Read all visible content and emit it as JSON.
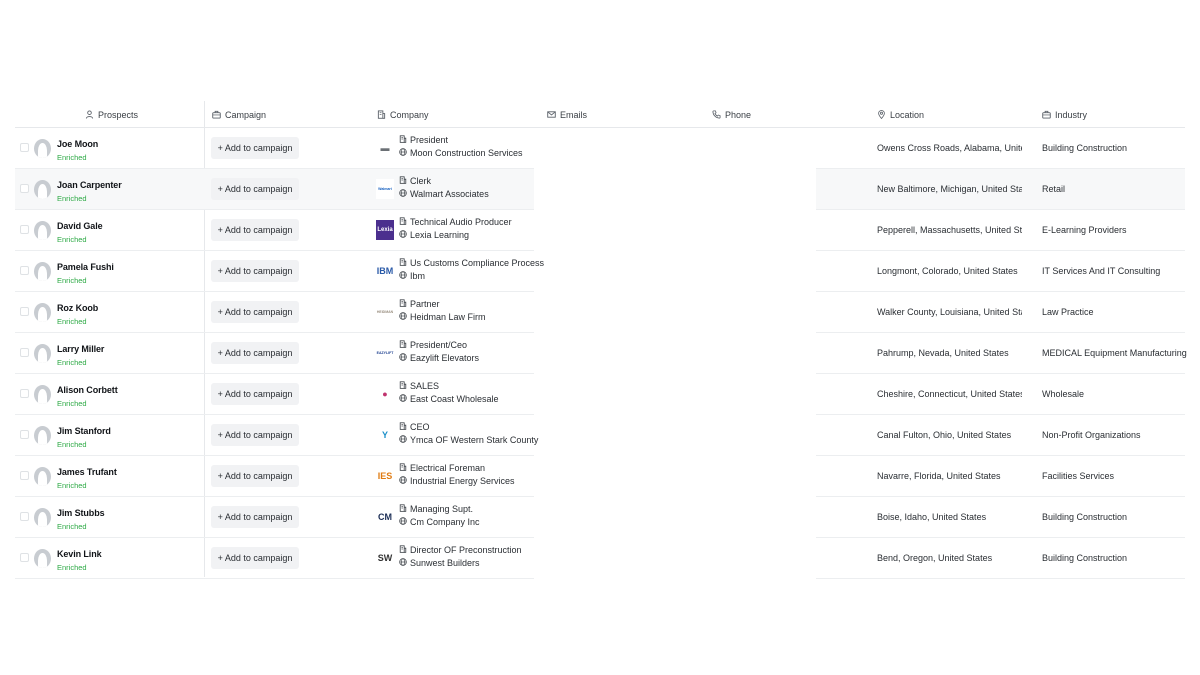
{
  "headers": {
    "prospects": "Prospects",
    "campaign": "Campaign",
    "company": "Company",
    "emails": "Emails",
    "phone": "Phone",
    "location": "Location",
    "industry": "Industry"
  },
  "icons": {
    "prospects": "person-icon",
    "campaign": "briefcase-icon",
    "company": "building-icon",
    "emails": "envelope-icon",
    "phone": "phone-icon",
    "location": "location-pin-icon",
    "industry": "briefcase-icon",
    "title": "building-icon",
    "website": "globe-icon"
  },
  "colors": {
    "enriched": "#2eaa46"
  },
  "add_to_campaign_label": "+ Add to campaign",
  "rows": [
    {
      "name": "Joe Moon",
      "status": "Enriched",
      "title": "President",
      "company": "Moon Construction Services",
      "location": "Owens Cross Roads, Alabama, United",
      "industry": "Building Construction",
      "logo": "▬",
      "logo_color": "#6b7075",
      "logo_bg": "#ffffff"
    },
    {
      "name": "Joan Carpenter",
      "status": "Enriched",
      "title": "Clerk",
      "company": "Walmart Associates",
      "location": "New Baltimore, Michigan, United State",
      "industry": "Retail",
      "logo": "Walmart",
      "logo_color": "#1a63c2",
      "logo_bg": "#ffffff"
    },
    {
      "name": "David Gale",
      "status": "Enriched",
      "title": "Technical Audio Producer",
      "company": "Lexia Learning",
      "location": "Pepperell, Massachusetts, United Stat",
      "industry": "E-Learning Providers",
      "logo": "Lexia",
      "logo_color": "#ffffff",
      "logo_bg": "#4b2f8e"
    },
    {
      "name": "Pamela Fushi",
      "status": "Enriched",
      "title": "Us Customs Compliance Process",
      "company": "Ibm",
      "location": "Longmont, Colorado, United States",
      "industry": "IT Services And IT Consulting",
      "logo": "IBM",
      "logo_color": "#2a5aa8",
      "logo_bg": "#ffffff"
    },
    {
      "name": "Roz Koob",
      "status": "Enriched",
      "title": "Partner",
      "company": "Heidman Law Firm",
      "location": "Walker County, Louisiana, United State",
      "industry": "Law Practice",
      "logo": "HEIDMAN",
      "logo_color": "#9a8f80",
      "logo_bg": "#ffffff"
    },
    {
      "name": "Larry Miller",
      "status": "Enriched",
      "title": "President/Ceo",
      "company": "Eazylift Elevators",
      "location": "Pahrump, Nevada, United States",
      "industry": "MEDICAL Equipment Manufacturing",
      "logo": "EAZYLIFT",
      "logo_color": "#1c3f8f",
      "logo_bg": "#ffffff"
    },
    {
      "name": "Alison Corbett",
      "status": "Enriched",
      "title": "SALES",
      "company": "East Coast Wholesale",
      "location": "Cheshire, Connecticut, United States",
      "industry": "Wholesale",
      "logo": "●",
      "logo_color": "#c0336e",
      "logo_bg": "#ffffff"
    },
    {
      "name": "Jim Stanford",
      "status": "Enriched",
      "title": "CEO",
      "company": "Ymca OF Western Stark County",
      "location": "Canal Fulton, Ohio, United States",
      "industry": "Non-Profit Organizations",
      "logo": "Y",
      "logo_color": "#1b8fc9",
      "logo_bg": "#ffffff"
    },
    {
      "name": "James Trufant",
      "status": "Enriched",
      "title": "Electrical Foreman",
      "company": "Industrial Energy Services",
      "location": "Navarre, Florida, United States",
      "industry": "Facilities Services",
      "logo": "IES",
      "logo_color": "#e07b12",
      "logo_bg": "#ffffff"
    },
    {
      "name": "Jim Stubbs",
      "status": "Enriched",
      "title": "Managing Supt.",
      "company": "Cm Company Inc",
      "location": "Boise, Idaho, United States",
      "industry": "Building Construction",
      "logo": "CM",
      "logo_color": "#1b2d55",
      "logo_bg": "#ffffff"
    },
    {
      "name": "Kevin Link",
      "status": "Enriched",
      "title": "Director OF Preconstruction",
      "company": "Sunwest Builders",
      "location": "Bend, Oregon, United States",
      "industry": "Building Construction",
      "logo": "SW",
      "logo_color": "#333333",
      "logo_bg": "#ffffff"
    }
  ]
}
